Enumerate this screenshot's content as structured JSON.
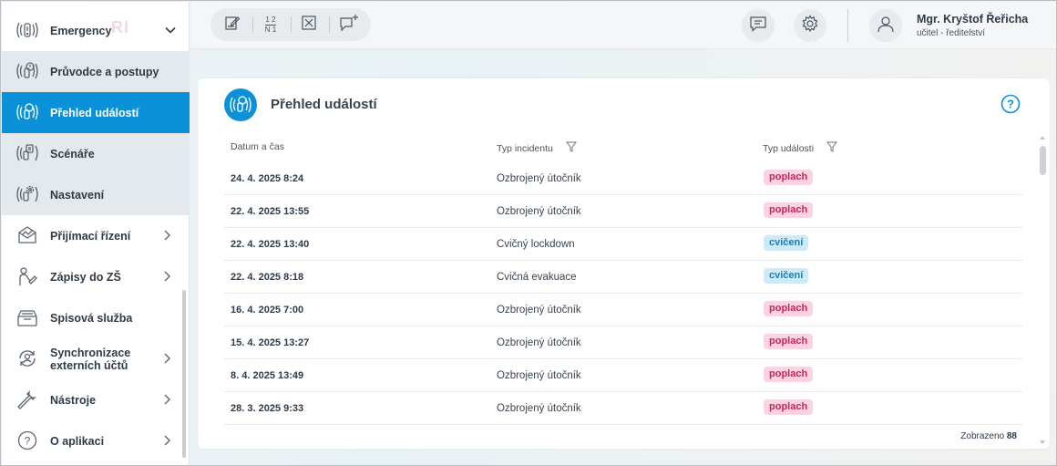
{
  "sidebar": {
    "watermark": "RI",
    "items": [
      {
        "label": "Emergency",
        "icon": "emergency-icon"
      },
      {
        "label": "Průvodce a postupy",
        "icon": "guide-icon"
      },
      {
        "label": "Přehled událostí",
        "icon": "events-overview-icon"
      },
      {
        "label": "Scénáře",
        "icon": "scenarios-icon"
      },
      {
        "label": "Nastavení",
        "icon": "settings-emergency-icon"
      },
      {
        "label": "Přijímací řízení",
        "icon": "admission-icon"
      },
      {
        "label": "Zápisy do ZŠ",
        "icon": "enrollment-icon"
      },
      {
        "label": "Spisová služba",
        "icon": "filing-icon"
      },
      {
        "label": "Synchronizace",
        "label2": "externích účtů",
        "icon": "sync-icon"
      },
      {
        "label": "Nástroje",
        "icon": "tools-icon"
      },
      {
        "label": "O aplikaci",
        "icon": "about-icon"
      }
    ]
  },
  "toolbar": {
    "tools": [
      "edit-icon",
      "numbering-icon",
      "cancel-box-icon",
      "add-comment-icon"
    ],
    "numbering_top": "1 2",
    "numbering_bottom": "N 1"
  },
  "user": {
    "name": "Mgr. Kryštof Řeřicha",
    "role": "učitel - ředitelství"
  },
  "card": {
    "title": "Přehled událostí",
    "columns": [
      "Datum a čas",
      "Typ incidentu",
      "Typ události"
    ],
    "rows": [
      {
        "date": "24. 4. 2025 8:24",
        "incident": "Ozbrojený útočník",
        "type": "poplach"
      },
      {
        "date": "22. 4. 2025 13:55",
        "incident": "Ozbrojený útočník",
        "type": "poplach"
      },
      {
        "date": "22. 4. 2025 13:40",
        "incident": "Cvičný lockdown",
        "type": "cvičení"
      },
      {
        "date": "22. 4. 2025 8:18",
        "incident": "Cvičná evakuace",
        "type": "cvičení"
      },
      {
        "date": "16. 4. 2025 7:00",
        "incident": "Ozbrojený útočník",
        "type": "poplach"
      },
      {
        "date": "15. 4. 2025 13:27",
        "incident": "Ozbrojený útočník",
        "type": "poplach"
      },
      {
        "date": "8. 4. 2025 13:49",
        "incident": "Ozbrojený útočník",
        "type": "poplach"
      },
      {
        "date": "28. 3. 2025 9:33",
        "incident": "Ozbrojený útočník",
        "type": "poplach"
      }
    ],
    "count_label": "Zobrazeno",
    "count_value": "88"
  },
  "colors": {
    "accent": "#0a91d7",
    "poplach_bg": "#fbd3e1",
    "poplach_fg": "#c4275d",
    "cviceni_bg": "#cfe9f6",
    "cviceni_fg": "#1380b8"
  }
}
